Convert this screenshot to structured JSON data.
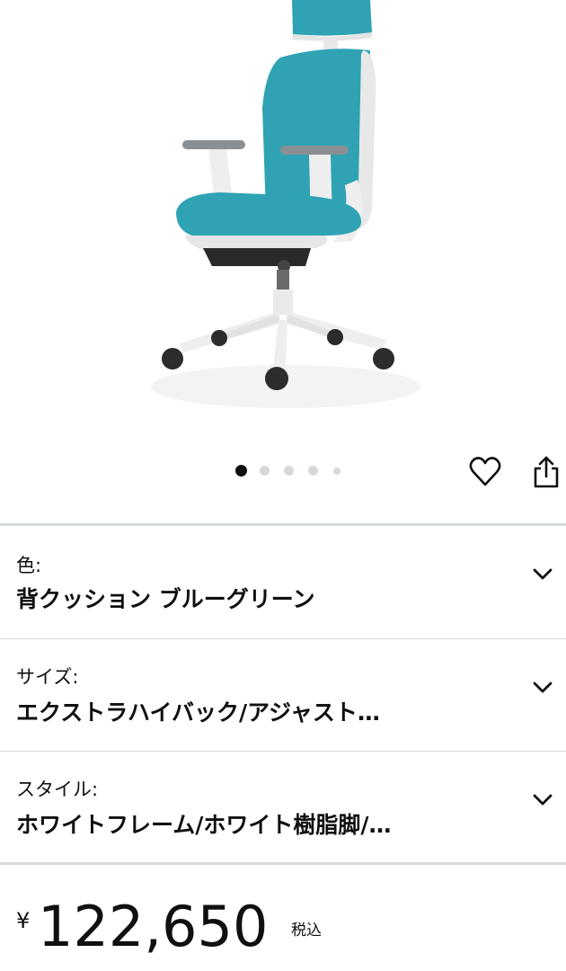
{
  "carousel": {
    "total": 5,
    "active": 0
  },
  "options": [
    {
      "label": "色:",
      "value": "背クッション ブルーグリーン"
    },
    {
      "label": "サイズ:",
      "value": "エクストラハイバック/アジャスト…"
    },
    {
      "label": "スタイル:",
      "value": "ホワイトフレーム/ホワイト樹脂脚/…"
    }
  ],
  "price": {
    "currency_symbol": "¥",
    "amount": "122,650",
    "tax_note": "税込"
  },
  "icons": {
    "favorite": "heart-icon",
    "share": "share-icon",
    "expand": "chevron-down-icon"
  },
  "colors": {
    "upholstery": "#2fa3b4",
    "frame": "#ececec",
    "text": "#0f1111",
    "divider": "#d5d9d9"
  }
}
